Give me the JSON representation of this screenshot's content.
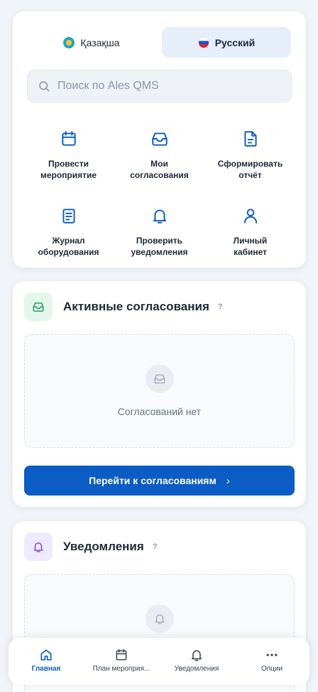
{
  "colors": {
    "accent": "#0b5cc4",
    "page_bg": "#f1f4f8",
    "green_tint": "#e3f6ec",
    "purple_tint": "#efe9fd"
  },
  "language": {
    "options": [
      {
        "label": "Қазақша",
        "icon": "kazakhstan-flag-icon",
        "selected": false
      },
      {
        "label": "Русский",
        "icon": "russia-flag-icon",
        "selected": true
      }
    ]
  },
  "search": {
    "placeholder": "Поиск по Ales QMS",
    "value": "",
    "icon": "search-icon"
  },
  "quick_actions": [
    {
      "line1": "Провести",
      "line2": "мероприятие",
      "icon": "calendar-icon"
    },
    {
      "line1": "Мои",
      "line2": "согласования",
      "icon": "inbox-icon"
    },
    {
      "line1": "Сформировать",
      "line2": "отчёт",
      "icon": "document-icon"
    },
    {
      "line1": "Журнал",
      "line2": "оборудования",
      "icon": "journal-icon"
    },
    {
      "line1": "Проверить",
      "line2": "уведомления",
      "icon": "bell-icon"
    },
    {
      "line1": "Личный",
      "line2": "кабинет",
      "icon": "user-icon"
    }
  ],
  "approvals": {
    "title": "Активные согласования",
    "help": "?",
    "icon": "inbox-icon",
    "empty_text": "Согласований нет",
    "button_label": "Перейти к согласованиям",
    "button_chevron": "›"
  },
  "notifications": {
    "title": "Уведомления",
    "help": "?",
    "icon": "bell-icon"
  },
  "bottom_nav": [
    {
      "label": "Главная",
      "icon": "home-icon",
      "active": true
    },
    {
      "label": "План мероприя...",
      "icon": "calendar-icon",
      "active": false
    },
    {
      "label": "Уведомления",
      "icon": "bell-icon",
      "active": false
    },
    {
      "label": "Опции",
      "icon": "more-icon",
      "active": false
    }
  ]
}
